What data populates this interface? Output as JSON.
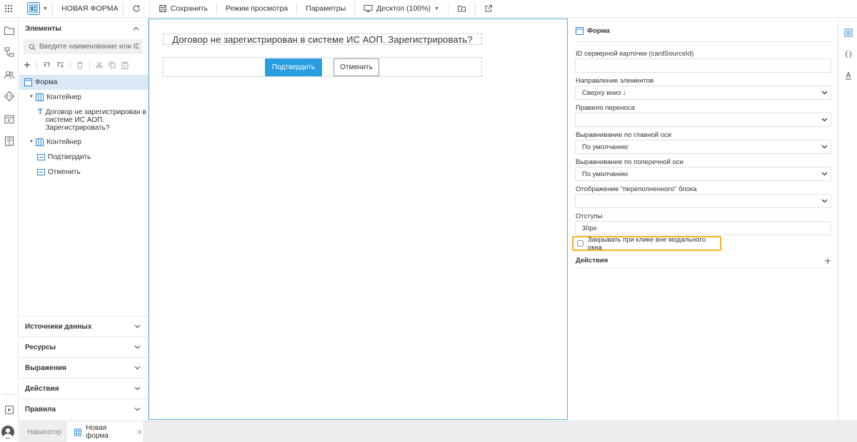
{
  "toolbar": {
    "form_title": "НОВАЯ ФОРМА",
    "save_label": "Сохранить",
    "preview_label": "Режим просмотра",
    "params_label": "Параметры",
    "device_label": "Десктоп (100%)"
  },
  "left_panel": {
    "title": "Элементы",
    "search_placeholder": "Введите наименование или ID",
    "tree": [
      {
        "label": "Форма"
      },
      {
        "label": "Контейнер"
      },
      {
        "label_lines": [
          "Договор не зарегистрирован в",
          "системе ИС АОП.",
          "Зарегистрировать?"
        ]
      },
      {
        "label": "Контейнер"
      },
      {
        "label": "Подтвердить"
      },
      {
        "label": "Отменить"
      }
    ],
    "sections": [
      "Источники данных",
      "Ресурсы",
      "Выражения",
      "Действия",
      "Правила"
    ]
  },
  "canvas": {
    "heading": "Договор не зарегистрирован в системе ИС АОП. Зарегистрировать?",
    "confirm_label": "Подтвердить",
    "cancel_label": "Отменить"
  },
  "properties": {
    "title": "Форма",
    "fields": [
      {
        "label": "ID серверной карточки (cardSourceId)",
        "value": ""
      },
      {
        "label": "Направление элементов",
        "value": "Сверху вниз ↓"
      },
      {
        "label": "Правило переноса",
        "value": ""
      },
      {
        "label": "Выравнивание по главной оси",
        "value": "По умолчанию"
      },
      {
        "label": "Выравнивание по поперечной оси",
        "value": "По умолчанию"
      },
      {
        "label": "Отображение \"переполненного\" блока",
        "value": ""
      },
      {
        "label": "Отступы",
        "value": "30px"
      }
    ],
    "checkbox_label": "Закрывать при клике вне модального окна",
    "checkbox_checked": false,
    "actions_label": "Действия"
  },
  "bottom": {
    "navigator_label": "Навигатор",
    "tab_label": "Новая форма",
    "close_glyph": "✕"
  },
  "colors": {
    "accent": "#2a9de0",
    "highlight": "#f0b429",
    "selection": "#dbe9f6"
  }
}
